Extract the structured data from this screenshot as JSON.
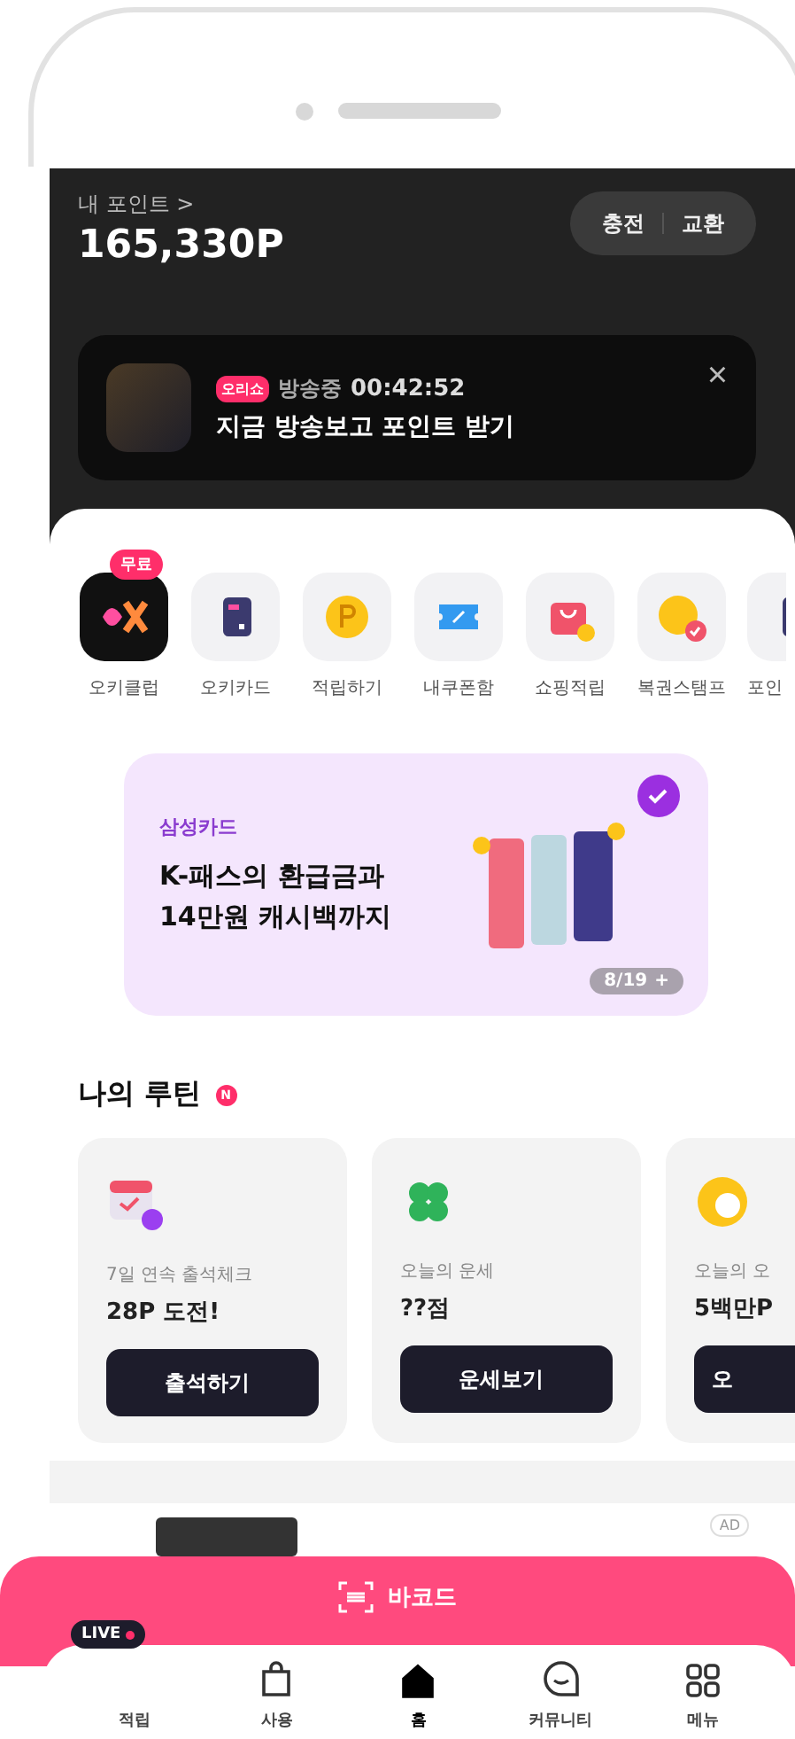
{
  "points": {
    "label": "내 포인트 >",
    "amount": "165,330P",
    "actions": [
      "충전",
      "교환"
    ]
  },
  "live_banner": {
    "tag": "오리쇼",
    "status": "방송중",
    "time": "00:42:52",
    "title": "지금 방송보고 포인트 받기",
    "close": "×"
  },
  "shortcuts": [
    {
      "kind": "okclub",
      "label": "오키클럽",
      "badge": "무료"
    },
    {
      "kind": "card",
      "label": "오키카드"
    },
    {
      "kind": "coin",
      "label": "적립하기"
    },
    {
      "kind": "coupon",
      "label": "내쿠폰함"
    },
    {
      "kind": "bag",
      "label": "쇼핑적립"
    },
    {
      "kind": "stamp",
      "label": "복권스탬프"
    },
    {
      "kind": "more",
      "label": "포인"
    }
  ],
  "promo": {
    "brand": "삼성카드",
    "title": "K-패스의 환급금과\n14만원 캐시백까지",
    "counter": "8/19",
    "plus": "+"
  },
  "routine": {
    "title": "나의 루틴",
    "badge": "N",
    "cards": [
      {
        "kind": "calendar",
        "caption": "7일 연속 출석체크",
        "headline": "28P 도전!",
        "button": "출석하기"
      },
      {
        "kind": "clover",
        "caption": "오늘의 운세",
        "headline": "??점",
        "button": "운세보기"
      },
      {
        "kind": "lotto",
        "caption": "오늘의 오",
        "headline": "5백만P",
        "button": "오"
      }
    ]
  },
  "ad": {
    "badge": "AD"
  },
  "barcode": {
    "label": "바코드"
  },
  "live_tag": "LIVE",
  "tabs": [
    {
      "kind": "earn",
      "label": "적립",
      "selected": false
    },
    {
      "kind": "use",
      "label": "사용",
      "selected": false
    },
    {
      "kind": "home",
      "label": "홈",
      "selected": true
    },
    {
      "kind": "community",
      "label": "커뮤니티",
      "selected": false
    },
    {
      "kind": "menu",
      "label": "메뉴",
      "selected": false
    }
  ]
}
